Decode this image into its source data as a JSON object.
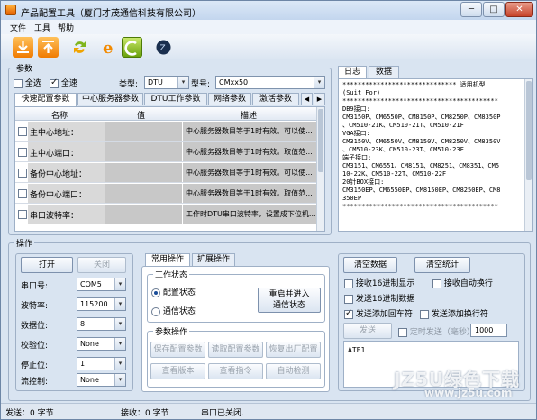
{
  "window": {
    "title": "产品配置工具（厦门才茂通信科技有限公司）",
    "min": "─",
    "max": "□",
    "close": "✕"
  },
  "menu": [
    "文件",
    "工具",
    "帮助"
  ],
  "toolbar": [
    "import",
    "export",
    "refresh",
    "ie",
    "active",
    "about"
  ],
  "params": {
    "group_label": "参数",
    "all_label": "全选",
    "full_label": "全速",
    "type_label": "类型:",
    "type_value": "DTU",
    "model_label": "型号:",
    "model_value": "CMxx50",
    "tabs": [
      "快速配置参数",
      "中心服务器参数",
      "DTU工作参数",
      "网络参数",
      "激活参数"
    ],
    "columns": [
      "名称",
      "值",
      "描述"
    ],
    "rows": [
      {
        "name": "主中心地址：",
        "desc": "中心服务器数目等于1时有效。可以使..."
      },
      {
        "name": "主中心端口：",
        "desc": "中心服务器数目等于1时有效。取值范..."
      },
      {
        "name": "备份中心地址：",
        "desc": "中心服务器数目等于1时有效。可以使..."
      },
      {
        "name": "备份中心端口：",
        "desc": "中心服务器数目等于1时有效。取值范..."
      },
      {
        "name": "串口波特率：",
        "desc": "工作时DTU串口波特率，设置成下位机..."
      }
    ]
  },
  "ops": {
    "group_label": "操作",
    "open": "打开",
    "close": "关闭",
    "fields": [
      {
        "label": "串口号:",
        "value": "COM5"
      },
      {
        "label": "波特率:",
        "value": "115200"
      },
      {
        "label": "数据位:",
        "value": "8"
      },
      {
        "label": "校验位:",
        "value": "None"
      },
      {
        "label": "停止位:",
        "value": "1"
      },
      {
        "label": "流控制:",
        "value": "None"
      }
    ],
    "tabs": [
      "常用操作",
      "扩展操作"
    ],
    "work_state_label": "工作状态",
    "config_state": "配置状态",
    "comm_state": "通信状态",
    "restart_btn_line1": "重启并进入",
    "restart_btn_line2": "通信状态",
    "param_ops_label": "参数操作",
    "btn_save": "保存配置参数",
    "btn_read": "读取配置参数",
    "btn_factory": "恢复出厂配置",
    "btn_version": "查看版本",
    "btn_cmd": "查看指令",
    "btn_detect": "自动检测"
  },
  "right": {
    "tabs": [
      "日志",
      "数据"
    ],
    "log": [
      "****************************** 适用机型",
      "(Suit For)",
      "*****************************************",
      "DB9接口:",
      "CM3150P、CM6550P、CM8150P、CM8250P、CM8350P",
      "、CM510-21K、CM510-21T、CM510-21F",
      "VGA接口:",
      "CM3150V、CM6550V、CM8150V、CM8250V、CM8350V",
      "、CM510-23K、CM510-23T、CM510-23F",
      "端子接口:",
      "CM3151、CM6551、CM8151、CM8251、CM8351、CM5",
      "10-22K、CM510-22T、CM510-22F",
      "20针BOX接口:",
      "CM3150EP、CM6550EP、CM8150EP、CM8250EP、CM8",
      "350EP",
      "*****************************************"
    ],
    "btn_clear_data": "清空数据",
    "btn_clear_stats": "清空统计",
    "opt_hex_recv": "接收16进制显示",
    "opt_auto_wrap": "接收自动换行",
    "opt_hex_send": "发送16进制数据",
    "opt_add_cr": "发送添加回车符",
    "opt_add_lf": "发送添加换行符",
    "send_label": "发送",
    "timed_send_label": "定时发送（毫秒）",
    "timed_value": "1000",
    "send_text": "ATE1"
  },
  "status": {
    "sent": "发送：0 字节",
    "received": "接收：0 字节",
    "port": "串口已关闭."
  },
  "watermark": {
    "big": "JZ5U绿色下载",
    "url": "www.jz5u.com"
  }
}
